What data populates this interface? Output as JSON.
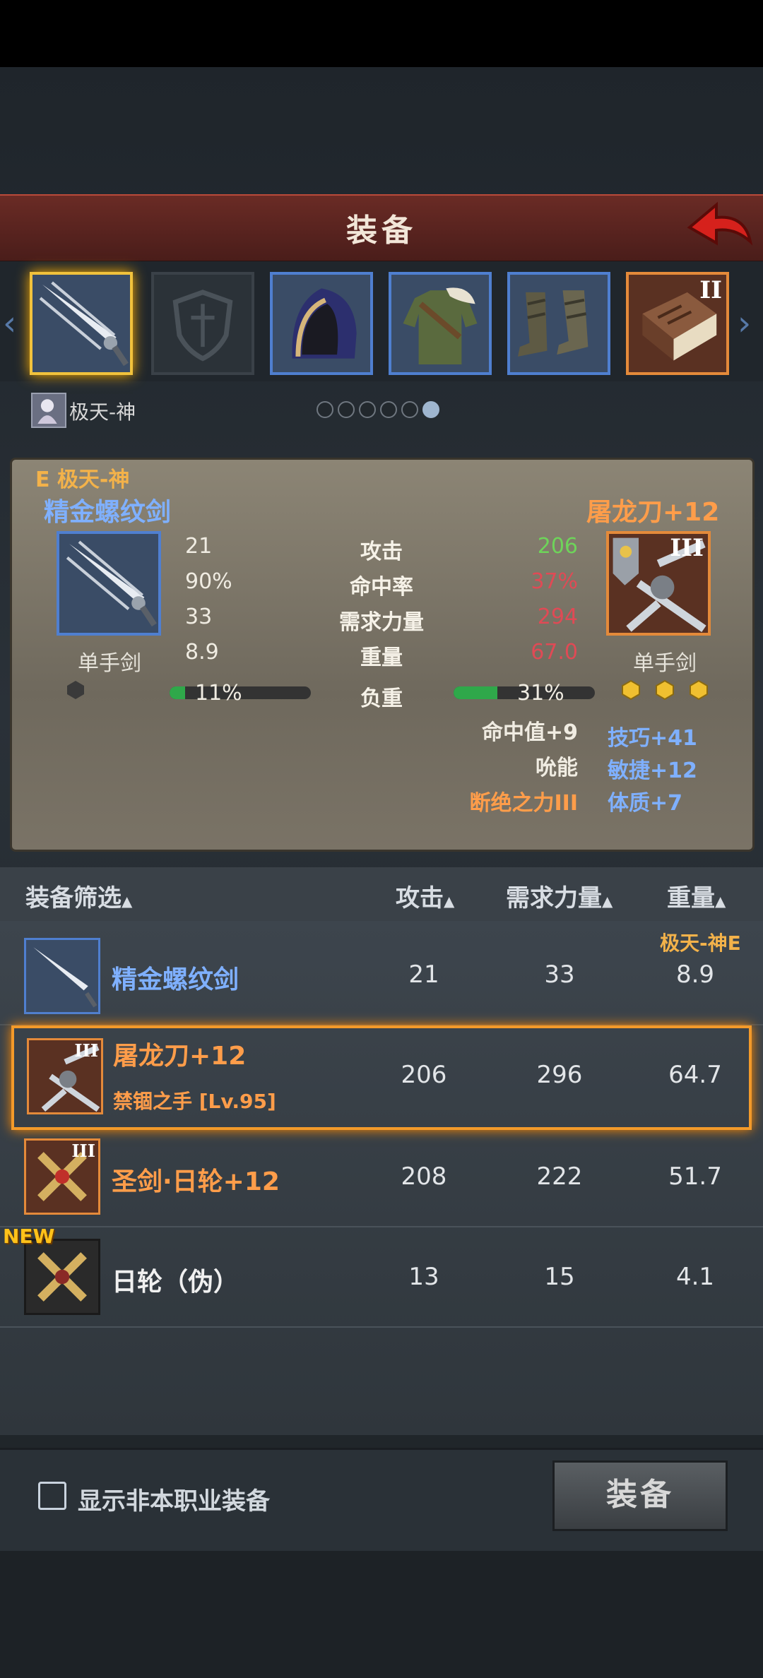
{
  "header": {
    "title": "装备"
  },
  "character": {
    "name": "极天-神"
  },
  "pager": {
    "pages": 6,
    "current": 6
  },
  "compare": {
    "owner_label": "E 极天-神",
    "left": {
      "name": "精金螺纹剑",
      "type": "单手剑"
    },
    "right": {
      "name": "屠龙刀+12",
      "type": "单手剑",
      "tier": "III"
    },
    "stats": [
      {
        "label": "攻击",
        "left": "21",
        "right": "206"
      },
      {
        "label": "命中率",
        "left": "90%",
        "right": "37%"
      },
      {
        "label": "需求力量",
        "left": "33",
        "right": "294"
      },
      {
        "label": "重量",
        "left": "8.9",
        "right": "67.0"
      }
    ],
    "load": {
      "label": "负重",
      "left": "11%",
      "right": "31%",
      "left_fraction": 0.11,
      "right_fraction": 0.31
    },
    "bonus_left": [
      "命中值+9",
      "吮能",
      "断绝之力III"
    ],
    "bonus_right": [
      "技巧+41",
      "敏捷+12",
      "体质+7"
    ]
  },
  "list": {
    "headers": {
      "filter": "装备筛选",
      "attack": "攻击",
      "str": "需求力量",
      "weight": "重量"
    },
    "equipped_tag": "极天-神E",
    "rows": [
      {
        "name": "精金螺纹剑",
        "sub": "",
        "attack": "21",
        "str": "33",
        "weight": "8.9"
      },
      {
        "name": "屠龙刀+12",
        "sub": "禁锢之手 [Lv.95]",
        "attack": "206",
        "str": "296",
        "weight": "64.7",
        "tier": "III"
      },
      {
        "name": "圣剑·日轮+12",
        "sub": "",
        "attack": "208",
        "str": "222",
        "weight": "51.7",
        "tier": "III"
      },
      {
        "name": "日轮（伪）",
        "sub": "",
        "attack": "13",
        "str": "15",
        "weight": "4.1",
        "badge": "NEW"
      }
    ]
  },
  "footer": {
    "checkbox_label": "显示非本职业装备",
    "equip_button": "装备"
  },
  "slots": {
    "tome_tier": "II"
  },
  "colors": {
    "header": "#5a221e",
    "selected": "#f39a2a",
    "rare_border": "#4f7fd0",
    "epic_border": "#e48a3a"
  }
}
